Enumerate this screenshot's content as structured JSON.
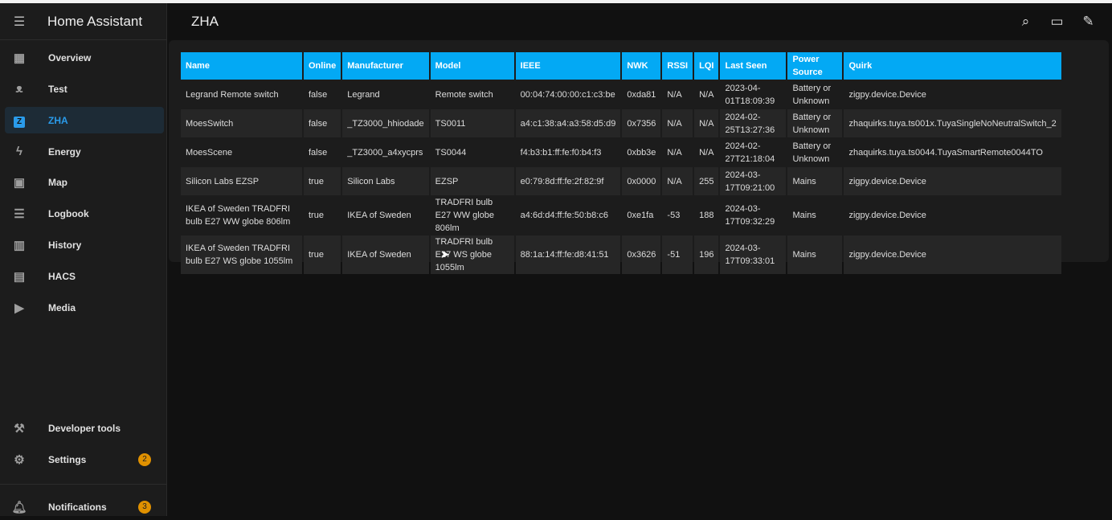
{
  "app": {
    "title": "Home Assistant",
    "page_title": "ZHA"
  },
  "sidebar": {
    "items": [
      {
        "label": "Overview",
        "icon": "view-dashboard-icon"
      },
      {
        "label": "Test",
        "icon": "teddy-bear-icon"
      },
      {
        "label": "ZHA",
        "icon": "zha-icon",
        "badge_letter": "Z"
      },
      {
        "label": "Energy",
        "icon": "lightning-icon"
      },
      {
        "label": "Map",
        "icon": "map-account-icon"
      },
      {
        "label": "Logbook",
        "icon": "list-icon"
      },
      {
        "label": "History",
        "icon": "chart-box-icon"
      },
      {
        "label": "HACS",
        "icon": "hacs-icon"
      },
      {
        "label": "Media",
        "icon": "play-box-icon"
      }
    ],
    "developer_tools": "Developer tools",
    "settings": "Settings",
    "settings_badge": "2",
    "notifications": "Notifications",
    "notifications_badge": "3"
  },
  "table": {
    "headers": [
      "Name",
      "Online",
      "Manufacturer",
      "Model",
      "IEEE",
      "NWK",
      "RSSI",
      "LQI",
      "Last Seen",
      "Power Source",
      "Quirk"
    ],
    "rows": [
      [
        "Legrand Remote switch",
        "false",
        "Legrand",
        "Remote switch",
        "00:04:74:00:00:c1:c3:be",
        "0xda81",
        "N/A",
        "N/A",
        "2023-04-01T18:09:39",
        "Battery or Unknown",
        "zigpy.device.Device"
      ],
      [
        "MoesSwitch",
        "false",
        "_TZ3000_hhiodade",
        "TS0011",
        "a4:c1:38:a4:a3:58:d5:d9",
        "0x7356",
        "N/A",
        "N/A",
        "2024-02-25T13:27:36",
        "Battery or Unknown",
        "zhaquirks.tuya.ts001x.TuyaSingleNoNeutralSwitch_2"
      ],
      [
        "MoesScene",
        "false",
        "_TZ3000_a4xycprs",
        "TS0044",
        "f4:b3:b1:ff:fe:f0:b4:f3",
        "0xbb3e",
        "N/A",
        "N/A",
        "2024-02-27T21:18:04",
        "Battery or Unknown",
        "zhaquirks.tuya.ts0044.TuyaSmartRemote0044TO"
      ],
      [
        "Silicon Labs EZSP",
        "true",
        "Silicon Labs",
        "EZSP",
        "e0:79:8d:ff:fe:2f:82:9f",
        "0x0000",
        "N/A",
        "255",
        "2024-03-17T09:21:00",
        "Mains",
        "zigpy.device.Device"
      ],
      [
        "IKEA of Sweden TRADFRI bulb E27 WW globe 806lm",
        "true",
        "IKEA of Sweden",
        "TRADFRI bulb E27 WW globe 806lm",
        "a4:6d:d4:ff:fe:50:b8:c6",
        "0xe1fa",
        "-53",
        "188",
        "2024-03-17T09:32:29",
        "Mains",
        "zigpy.device.Device"
      ],
      [
        "IKEA of Sweden TRADFRI bulb E27 WS globe 1055lm",
        "true",
        "IKEA of Sweden",
        "TRADFRI bulb E27 WS globe 1055lm",
        "88:1a:14:ff:fe:d8:41:51",
        "0x3626",
        "-51",
        "196",
        "2024-03-17T09:33:01",
        "Mains",
        "zigpy.device.Device"
      ]
    ]
  },
  "colors": {
    "accent": "#03a9f4",
    "active": "#2a9bea",
    "badge": "#e09100"
  }
}
